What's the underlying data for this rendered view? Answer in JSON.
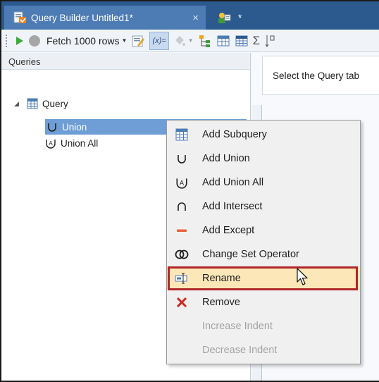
{
  "tabs": [
    {
      "label": "Query Builder Untitled1*",
      "close": "×",
      "icon": "query-builder-icon"
    },
    {
      "label": "*",
      "icon": "user-connection-icon"
    }
  ],
  "toolbar": {
    "fetch_label": "Fetch 1000 rows",
    "expr_label": "(x)=",
    "sum_label": "Σ"
  },
  "queries_panel": {
    "title": "Queries",
    "tree": {
      "root": "Query",
      "children": [
        "Union",
        "Union All"
      ]
    }
  },
  "right_panel": {
    "hint": "Select the Query tab"
  },
  "context_menu": {
    "items": [
      {
        "label": "Add Subquery",
        "icon": "subquery-icon",
        "enabled": true
      },
      {
        "label": "Add Union",
        "icon": "union-icon",
        "enabled": true
      },
      {
        "label": "Add Union All",
        "icon": "union-all-icon",
        "enabled": true
      },
      {
        "label": "Add Intersect",
        "icon": "intersect-icon",
        "enabled": true
      },
      {
        "label": "Add Except",
        "icon": "except-icon",
        "enabled": true
      },
      {
        "label": "Change Set Operator",
        "icon": "set-operator-icon",
        "enabled": true
      },
      {
        "label": "Rename",
        "icon": "rename-icon",
        "enabled": true
      },
      {
        "label": "Remove",
        "icon": "remove-icon",
        "enabled": true
      },
      {
        "label": "Increase Indent",
        "icon": "",
        "enabled": false
      },
      {
        "label": "Decrease Indent",
        "icon": "",
        "enabled": false
      }
    ]
  },
  "colors": {
    "tab_strip": "#2c5a8e",
    "selection": "#6f9ed6",
    "highlight_border": "#b0262a"
  }
}
